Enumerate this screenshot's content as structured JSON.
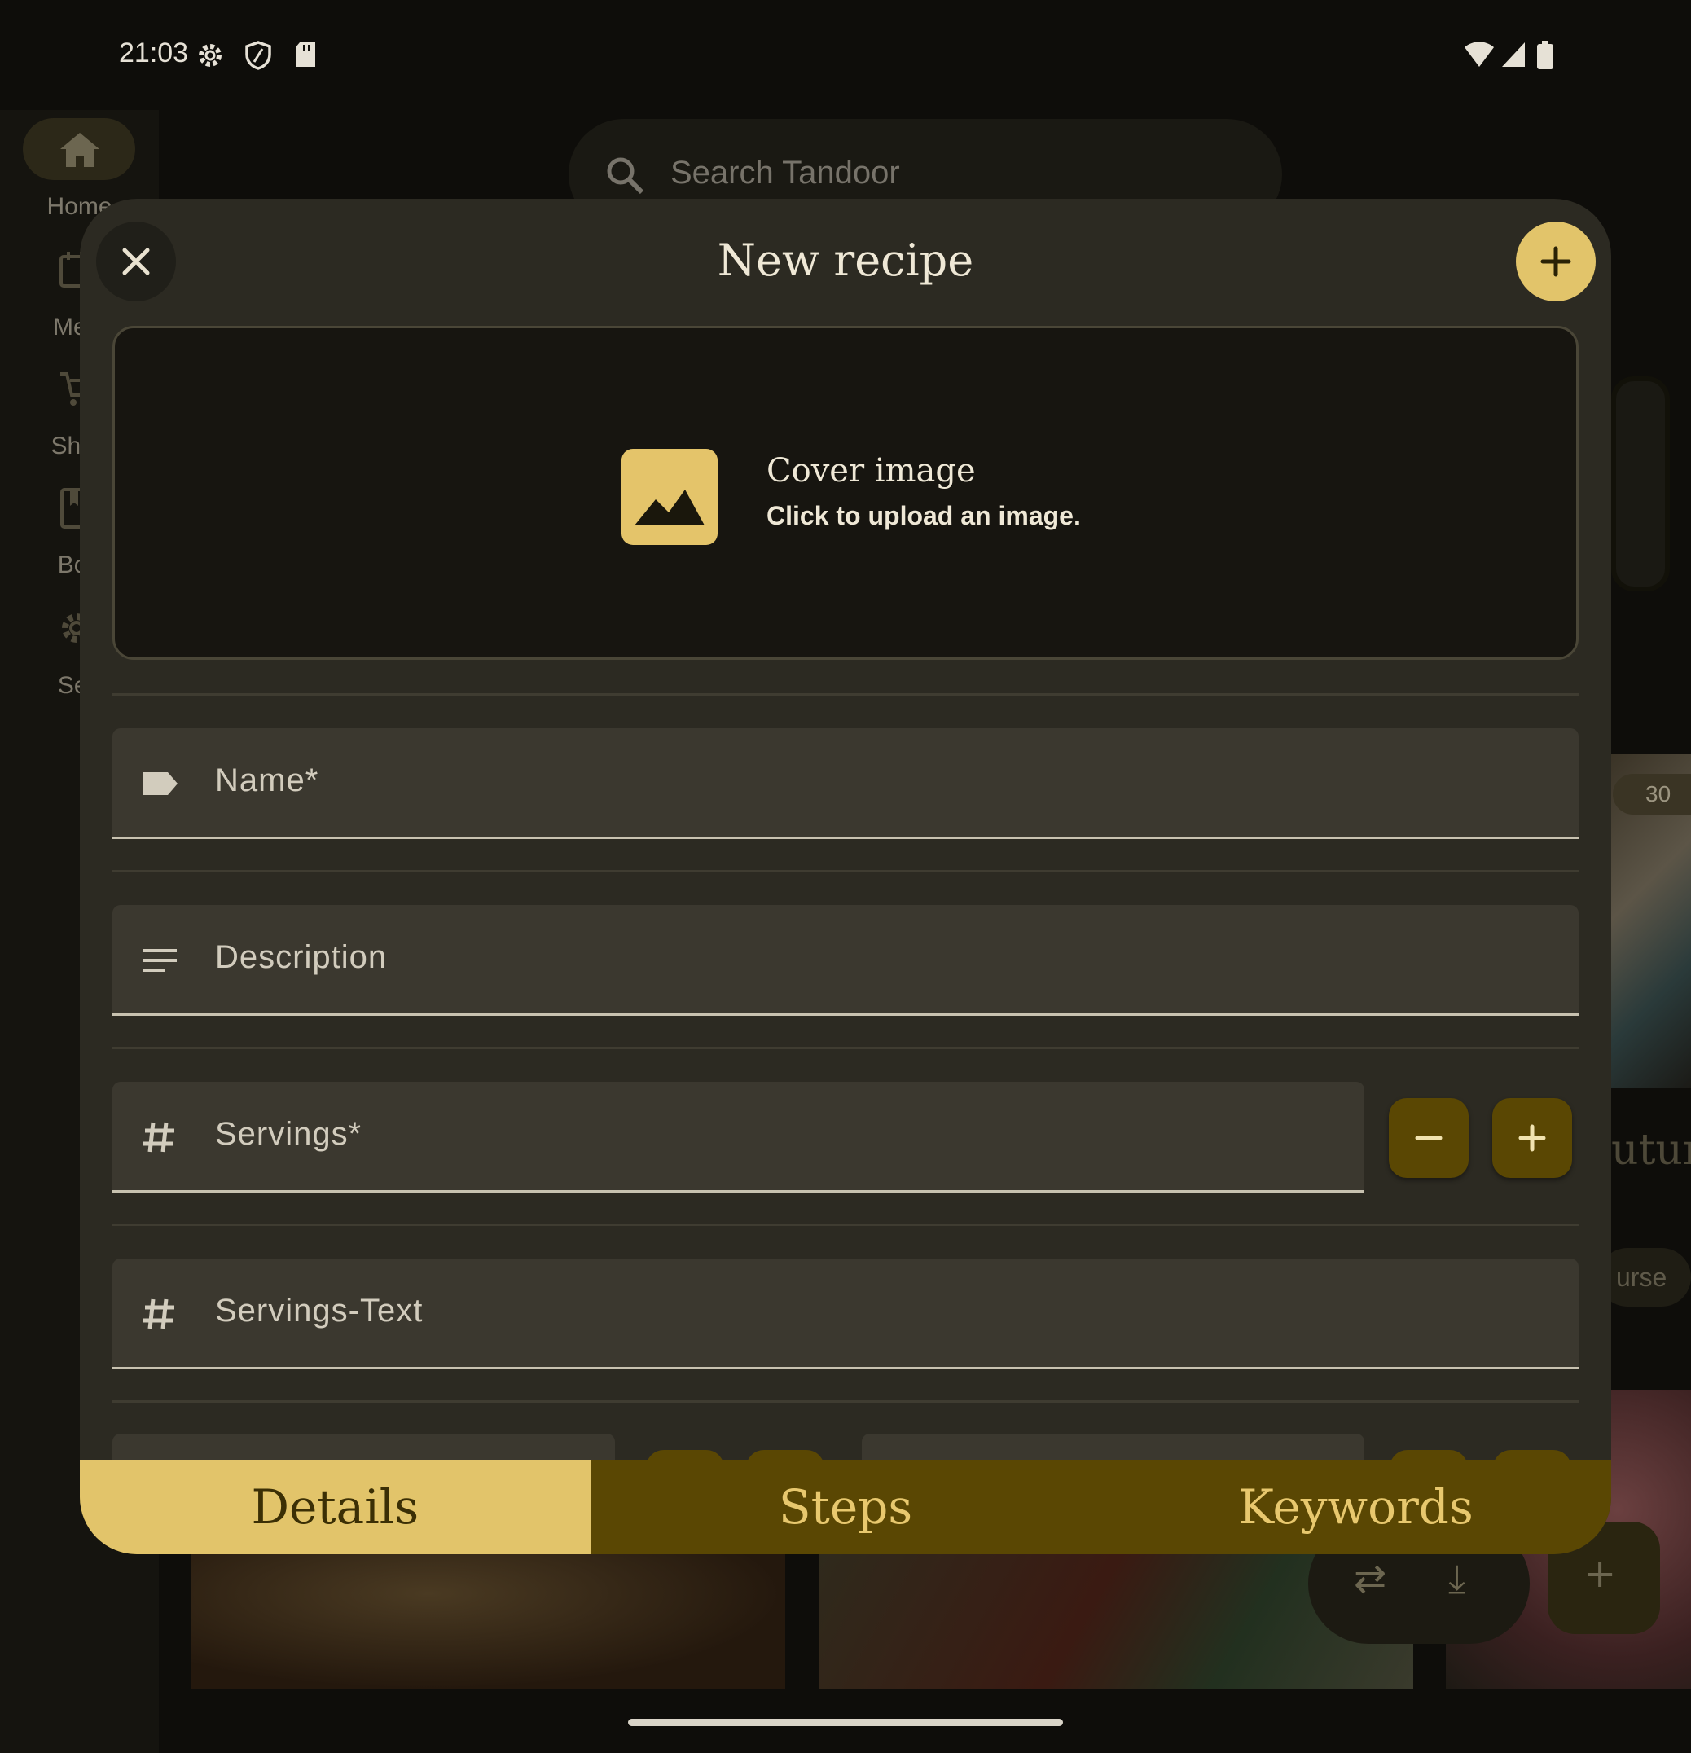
{
  "status_bar": {
    "time": "21:03",
    "left_icons": [
      "settings-icon",
      "shield-icon",
      "sd-card-icon"
    ],
    "right_icons": [
      "wifi-icon",
      "signal-icon",
      "battery-icon"
    ]
  },
  "background": {
    "nav_rail": [
      {
        "label": "Home",
        "icon": "home-icon"
      },
      {
        "label": "Meal",
        "icon": "calendar-icon"
      },
      {
        "label": "Shop",
        "icon": "cart-icon"
      },
      {
        "label": "Boo",
        "icon": "book-icon"
      },
      {
        "label": "Sett",
        "icon": "settings-icon"
      }
    ],
    "search_placeholder": "Search Tandoor",
    "badge_partial": "30",
    "title_partial": "utur",
    "chip_partial": "urse"
  },
  "dialog": {
    "title": "New recipe",
    "cover": {
      "title": "Cover image",
      "subtitle": "Click to upload an image."
    },
    "fields": {
      "name": "Name*",
      "description": "Description",
      "servings": "Servings*",
      "servings_text": "Servings-Text"
    },
    "tabs": [
      {
        "label": "Details",
        "active": true
      },
      {
        "label": "Steps",
        "active": false
      },
      {
        "label": "Keywords",
        "active": false
      }
    ]
  },
  "colors": {
    "accent": "#e2c46a",
    "accent_dark": "#5a4703",
    "dialog_bg": "#2c2a22",
    "field_bg": "#3b382f"
  }
}
